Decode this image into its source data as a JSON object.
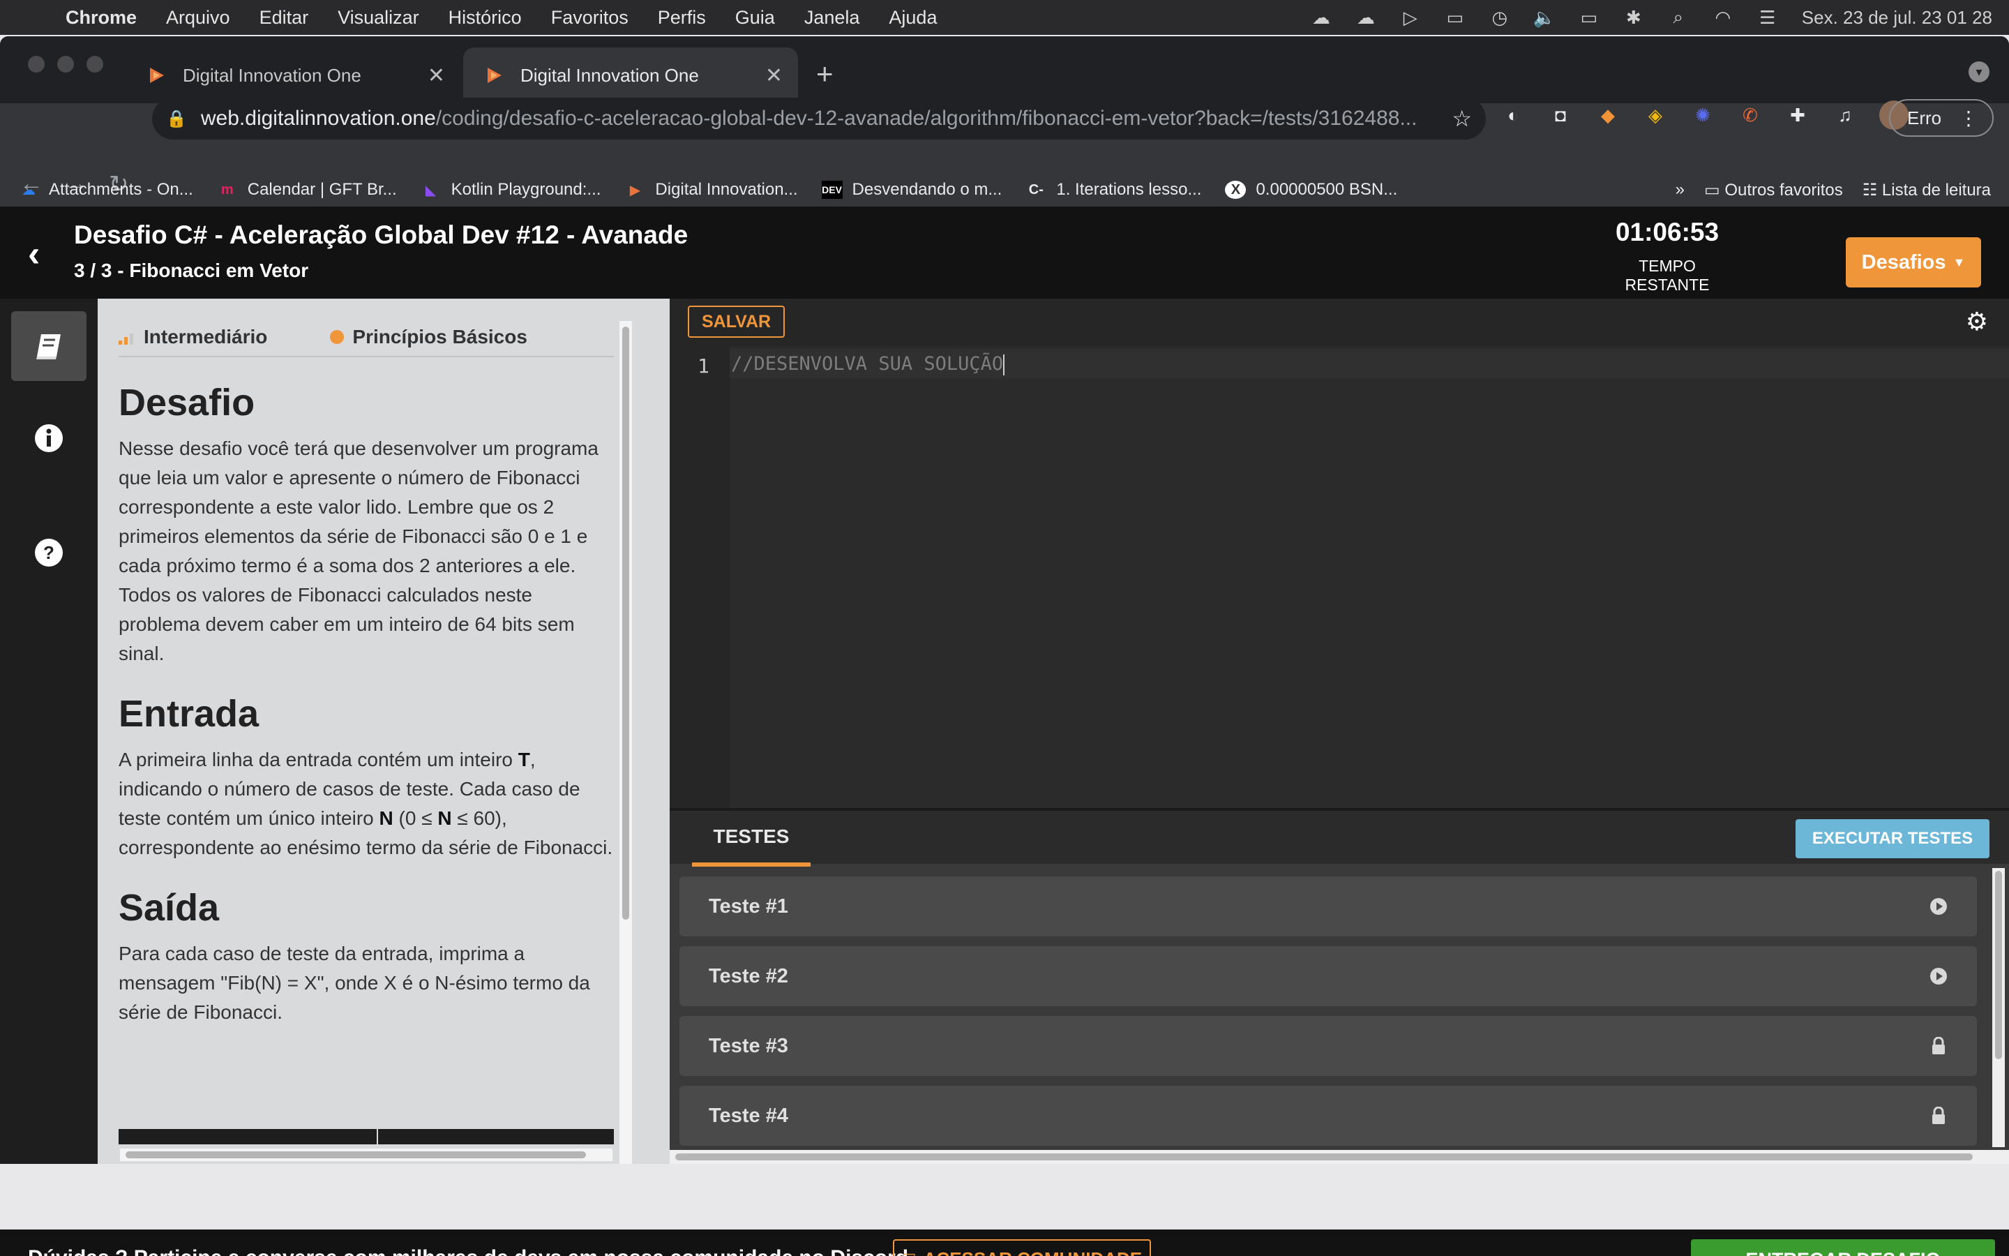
{
  "menubar": {
    "app": "Chrome",
    "items": [
      "Arquivo",
      "Editar",
      "Visualizar",
      "Histórico",
      "Favoritos",
      "Perfis",
      "Guia",
      "Janela",
      "Ajuda"
    ],
    "datetime": "Sex. 23 de jul.  23 01 28"
  },
  "tabs": [
    {
      "title": "Digital Innovation One",
      "active": false
    },
    {
      "title": "Digital Innovation One",
      "active": true
    }
  ],
  "omnibox": {
    "host": "web.digitalinnovation.one",
    "path": "/coding/desafio-c-aceleracao-global-dev-12-avanade/algorithm/fibonacci-em-vetor?back=/tests/3162488..."
  },
  "profile_button": {
    "label": "Erro"
  },
  "bookmarks": [
    {
      "label": "Attachments - On...",
      "icon": "onedrive-icon"
    },
    {
      "label": "Calendar | GFT Br...",
      "icon": "m-logo-icon"
    },
    {
      "label": "Kotlin Playground:...",
      "icon": "kotlin-icon"
    },
    {
      "label": "Digital Innovation...",
      "icon": "dio-icon"
    },
    {
      "label": "Desvendando o m...",
      "icon": "dev-icon"
    },
    {
      "label": "1. Iterations lesso...",
      "icon": "codility-icon"
    },
    {
      "label": "0.00000500 BSN...",
      "icon": "x-icon"
    }
  ],
  "bookmarks_right": {
    "more": "»",
    "other": "Outros favoritos",
    "reading_list": "Lista de leitura"
  },
  "header": {
    "title": "Desafio C# - Aceleração Global Dev #12 - Avanade",
    "subtitle": "3 / 3 - Fibonacci em Vetor",
    "timer_value": "01:06:53",
    "timer_label": "TEMPO RESTANTE",
    "desafios_button": "Desafios"
  },
  "description": {
    "level": "Intermediário",
    "category": "Princípios Básicos",
    "desafio_title": "Desafio",
    "desafio_text": "Nesse desafio você terá que desenvolver um programa que leia um valor e apresente o número de Fibonacci correspondente a este valor lido. Lembre que os 2 primeiros elementos da série de Fibonacci são 0 e 1 e cada próximo termo é a soma dos 2 anteriores a ele. Todos os valores de Fibonacci calculados neste problema devem caber em um inteiro de 64 bits sem sinal.",
    "entrada_title": "Entrada",
    "entrada_p1": "A primeira linha da entrada contém um inteiro ",
    "entrada_T": "T",
    "entrada_p2": ", indicando o número de casos de teste. Cada caso de teste contém um único inteiro ",
    "entrada_N1": "N",
    "entrada_p3": " (0 ≤ ",
    "entrada_N2": "N",
    "entrada_p4": " ≤ 60), correspondente ao enésimo termo da série de Fibonacci.",
    "saida_title": "Saída",
    "saida_text": "Para cada caso de teste da entrada, imprima a mensagem \"Fib(N) = X\", onde X é o N-ésimo termo da série de Fibonacci."
  },
  "editor": {
    "save_label": "SALVAR",
    "line_number": "1",
    "code": "//DESENVOLVA SUA SOLUÇÃO"
  },
  "tests": {
    "tab_label": "TESTES",
    "run_button": "EXECUTAR TESTES",
    "items": [
      {
        "name": "Teste #1",
        "status_icon": "play-icon"
      },
      {
        "name": "Teste #2",
        "status_icon": "play-icon"
      },
      {
        "name": "Teste #3",
        "status_icon": "lock-icon"
      },
      {
        "name": "Teste #4",
        "status_icon": "lock-icon"
      }
    ]
  },
  "footer": {
    "message": "Dúvidas ?  Participe e converse com milhares de devs em nossa comunidade no Discord.",
    "community_button": "ACESSAR COMUNIDADE",
    "deliver_button": "ENTREGAR DESAFIO"
  },
  "colors": {
    "accent": "#f0963a",
    "run_button": "#6cb6d8",
    "deliver_button": "#3a9c2f",
    "header_bg": "#121212"
  }
}
